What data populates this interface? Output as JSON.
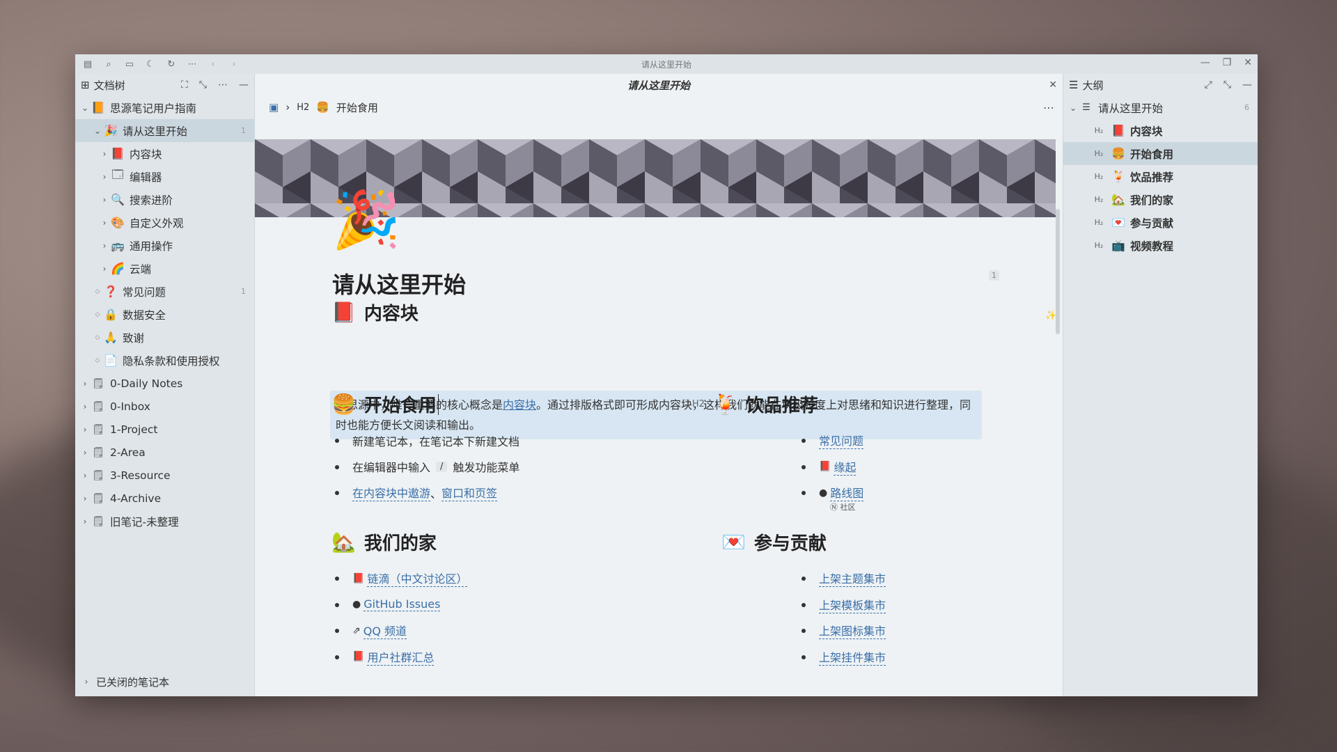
{
  "window": {
    "title": "请从这里开始",
    "toolbar_icons": [
      "workspace-icon",
      "search-icon",
      "layout-icon",
      "moon-icon",
      "sync-icon",
      "more-icon",
      "back-icon",
      "forward-icon"
    ],
    "controls": [
      "—",
      "❐",
      "✕"
    ]
  },
  "left": {
    "title": "文档树",
    "notebook": {
      "label": "思源笔记用户指南"
    },
    "items": [
      {
        "label": "请从这里开始",
        "icon": "🎉",
        "count": "1",
        "level": 1,
        "chevron": "v",
        "active": true
      },
      {
        "label": "内容块",
        "icon": "📕",
        "level": 2,
        "chevron": ">"
      },
      {
        "label": "编辑器",
        "icon": "🗔",
        "level": 2,
        "chevron": ">"
      },
      {
        "label": "搜索进阶",
        "icon": "🔍",
        "level": 2,
        "chevron": ">"
      },
      {
        "label": "自定义外观",
        "icon": "🎨",
        "level": 2,
        "chevron": ">"
      },
      {
        "label": "通用操作",
        "icon": "🚌",
        "level": 2,
        "chevron": ">"
      },
      {
        "label": "云端",
        "icon": "🌈",
        "level": 2,
        "chevron": ">"
      },
      {
        "label": "常见问题",
        "icon": "❓",
        "count": "1",
        "level": 1,
        "chevron": "◇"
      },
      {
        "label": "数据安全",
        "icon": "🔒",
        "level": 1,
        "chevron": "◇"
      },
      {
        "label": "致谢",
        "icon": "🙏",
        "level": 1,
        "chevron": "◇"
      },
      {
        "label": "隐私条款和使用授权",
        "icon": "📄",
        "level": 1,
        "chevron": "◇"
      }
    ],
    "notebooks": [
      "0-Daily Notes",
      "0-Inbox",
      "1-Project",
      "2-Area",
      "3-Resource",
      "4-Archive",
      "旧笔记-未整理"
    ],
    "closed_label": "已关闭的笔记本"
  },
  "editor": {
    "tab_title": "请从这里开始",
    "breadcrumb": {
      "level": "H2",
      "emoji": "🍔",
      "label": "开始食用"
    },
    "doc_icon": "🎉",
    "doc_title": "请从这里开始",
    "title_count": "1",
    "sections": {
      "content_block": {
        "title": "内容块",
        "emoji": "📕"
      },
      "para": {
        "before": "在思源中，唯一重要的核心概念是",
        "link": "内容块",
        "after": "。通过排版格式即可形成内容块，这样我们就能在块级粒度上对思绪和知识进行整理，同时也能方便长文阅读和输出。"
      },
      "start": {
        "title": "开始食用",
        "emoji": "🍔",
        "items": [
          "新建笔记本，在笔记本下新建文档",
          "在编辑器中输入",
          "/",
          "触发功能菜单",
          "在内容块中遨游",
          "、",
          "窗口和页签"
        ]
      },
      "drinks": {
        "title": "饮品推荐",
        "emoji": "🍹",
        "marker": "H2",
        "items": [
          "常见问题",
          "缘起",
          "路线图"
        ]
      },
      "home": {
        "title": "我们的家",
        "emoji": "🏡",
        "items": [
          "链滴（中文讨论区）",
          "GitHub Issues",
          "QQ 频道",
          "用户社群汇总"
        ]
      },
      "community_tag": "Ⓝ 社区",
      "contribute": {
        "title": "参与贡献",
        "emoji": "💌",
        "items": [
          "上架主题集市",
          "上架模板集市",
          "上架图标集市",
          "上架挂件集市"
        ]
      }
    }
  },
  "outline": {
    "title": "大纲",
    "root": {
      "label": "请从这里开始",
      "count": "6"
    },
    "items": [
      {
        "label": "内容块",
        "emoji": "📕"
      },
      {
        "label": "开始食用",
        "emoji": "🍔",
        "active": true
      },
      {
        "label": "饮品推荐",
        "emoji": "🍹"
      },
      {
        "label": "我们的家",
        "emoji": "🏡"
      },
      {
        "label": "参与贡献",
        "emoji": "💌"
      },
      {
        "label": "视频教程",
        "emoji": "📺"
      }
    ]
  },
  "colors": {
    "accent": "#3b6fa8",
    "highlight": "#d7e6f2",
    "active_row": "#cbd7df"
  }
}
